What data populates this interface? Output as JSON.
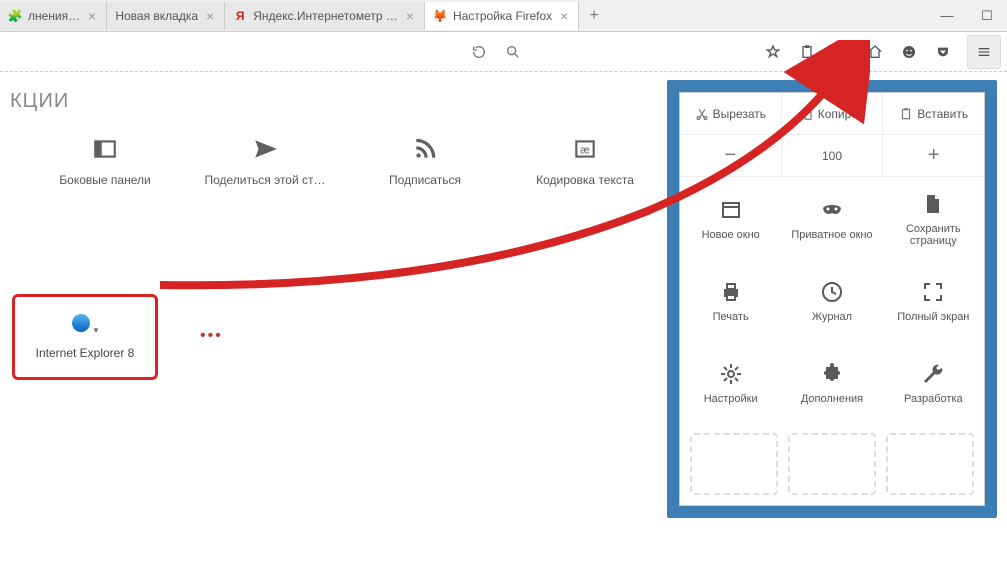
{
  "tabs": [
    {
      "label": "лнения…",
      "favicon": "puzzle"
    },
    {
      "label": "Новая вкладка",
      "favicon": ""
    },
    {
      "label": "Яндекс.Интернетометр …",
      "favicon": "yandex"
    },
    {
      "label": "Настройка Firefox",
      "favicon": "ff",
      "active": true
    }
  ],
  "section_title": "КЦИИ",
  "tools": [
    {
      "label": "Боковые панели",
      "icon": "sidebar"
    },
    {
      "label": "Поделиться этой ст…",
      "icon": "share"
    },
    {
      "label": "Подписаться",
      "icon": "rss"
    },
    {
      "label": "Кодировка текста",
      "icon": "encoding"
    }
  ],
  "highlight_label": "Internet Explorer 8",
  "menu": {
    "cut": "Вырезать",
    "copy": "Копиров",
    "paste": "Вставить",
    "zoom": "100",
    "items": [
      {
        "label": "Новое окно",
        "icon": "window"
      },
      {
        "label": "Приватное окно",
        "icon": "mask"
      },
      {
        "label": "Сохранить страницу",
        "icon": "file"
      },
      {
        "label": "Печать",
        "icon": "print"
      },
      {
        "label": "Журнал",
        "icon": "history"
      },
      {
        "label": "Полный экран",
        "icon": "fullscreen"
      },
      {
        "label": "Настройки",
        "icon": "gear"
      },
      {
        "label": "Дополнения",
        "icon": "puzzle"
      },
      {
        "label": "Разработка",
        "icon": "wrench"
      }
    ]
  }
}
